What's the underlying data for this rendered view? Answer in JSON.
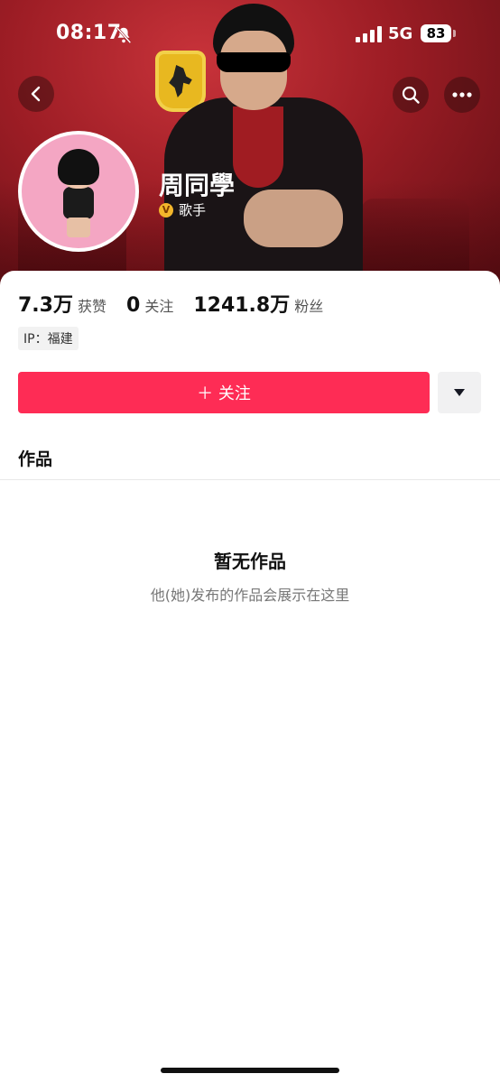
{
  "status_bar": {
    "time": "08:17",
    "network": "5G",
    "battery": "83"
  },
  "profile": {
    "name": "周同學",
    "verified_label": "歌手",
    "verified_badge": "V",
    "ip_location": "IP：福建"
  },
  "stats": [
    {
      "value": "7.3万",
      "label": "获赞"
    },
    {
      "value": "0",
      "label": "关注"
    },
    {
      "value": "1241.8万",
      "label": "粉丝"
    }
  ],
  "actions": {
    "follow_label": "＋ 关注"
  },
  "tabs": {
    "works_label": "作品"
  },
  "empty_state": {
    "title": "暂无作品",
    "subtitle": "他(她)发布的作品会展示在这里"
  },
  "colors": {
    "accent": "#fe2c55",
    "banner": "#9d1d25"
  }
}
